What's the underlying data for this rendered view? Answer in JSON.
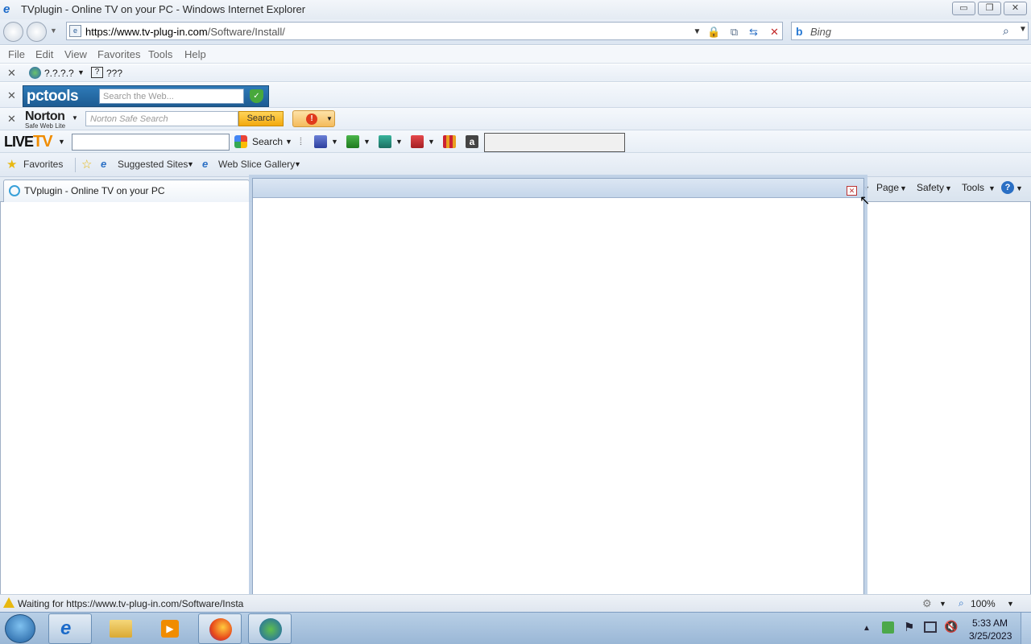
{
  "window": {
    "title": "TVplugin - Online TV on your PC - Windows Internet Explorer",
    "min_glyph": "▭",
    "restore_glyph": "❐",
    "close_glyph": "✕"
  },
  "address_bar": {
    "url_scheme_host": "https://www.tv-plug-in.com",
    "url_path": "/Software/Install/"
  },
  "search": {
    "placeholder": "Bing"
  },
  "menu": {
    "items": [
      "File",
      "Edit",
      "View",
      "Favorites",
      "Tools",
      "Help"
    ]
  },
  "toolbar_unknown": {
    "label1": "?.?.?.?",
    "label2": "???"
  },
  "pctools": {
    "logo": "pctools",
    "search_placeholder": "Search the Web..."
  },
  "norton": {
    "logo": "Norton",
    "sublabel": "Safe Web Lite",
    "search_placeholder": "Norton Safe Search",
    "search_button": "Search"
  },
  "livetv": {
    "logo_live": "LIVE",
    "logo_tv": "TV",
    "search_label": "Search"
  },
  "favorites_bar": {
    "favorites_label": "Favorites",
    "suggested_sites": "Suggested Sites",
    "web_slice_gallery": "Web Slice Gallery"
  },
  "tab": {
    "label": "TVplugin - Online TV on your PC"
  },
  "command_bar": {
    "page": "Page",
    "safety": "Safety",
    "tools": "Tools"
  },
  "status": {
    "text": "Waiting for https://www.tv-plug-in.com/Software/Insta",
    "zoom": "100%"
  },
  "taskbar": {
    "time": "5:33 AM",
    "date": "3/25/2023"
  }
}
